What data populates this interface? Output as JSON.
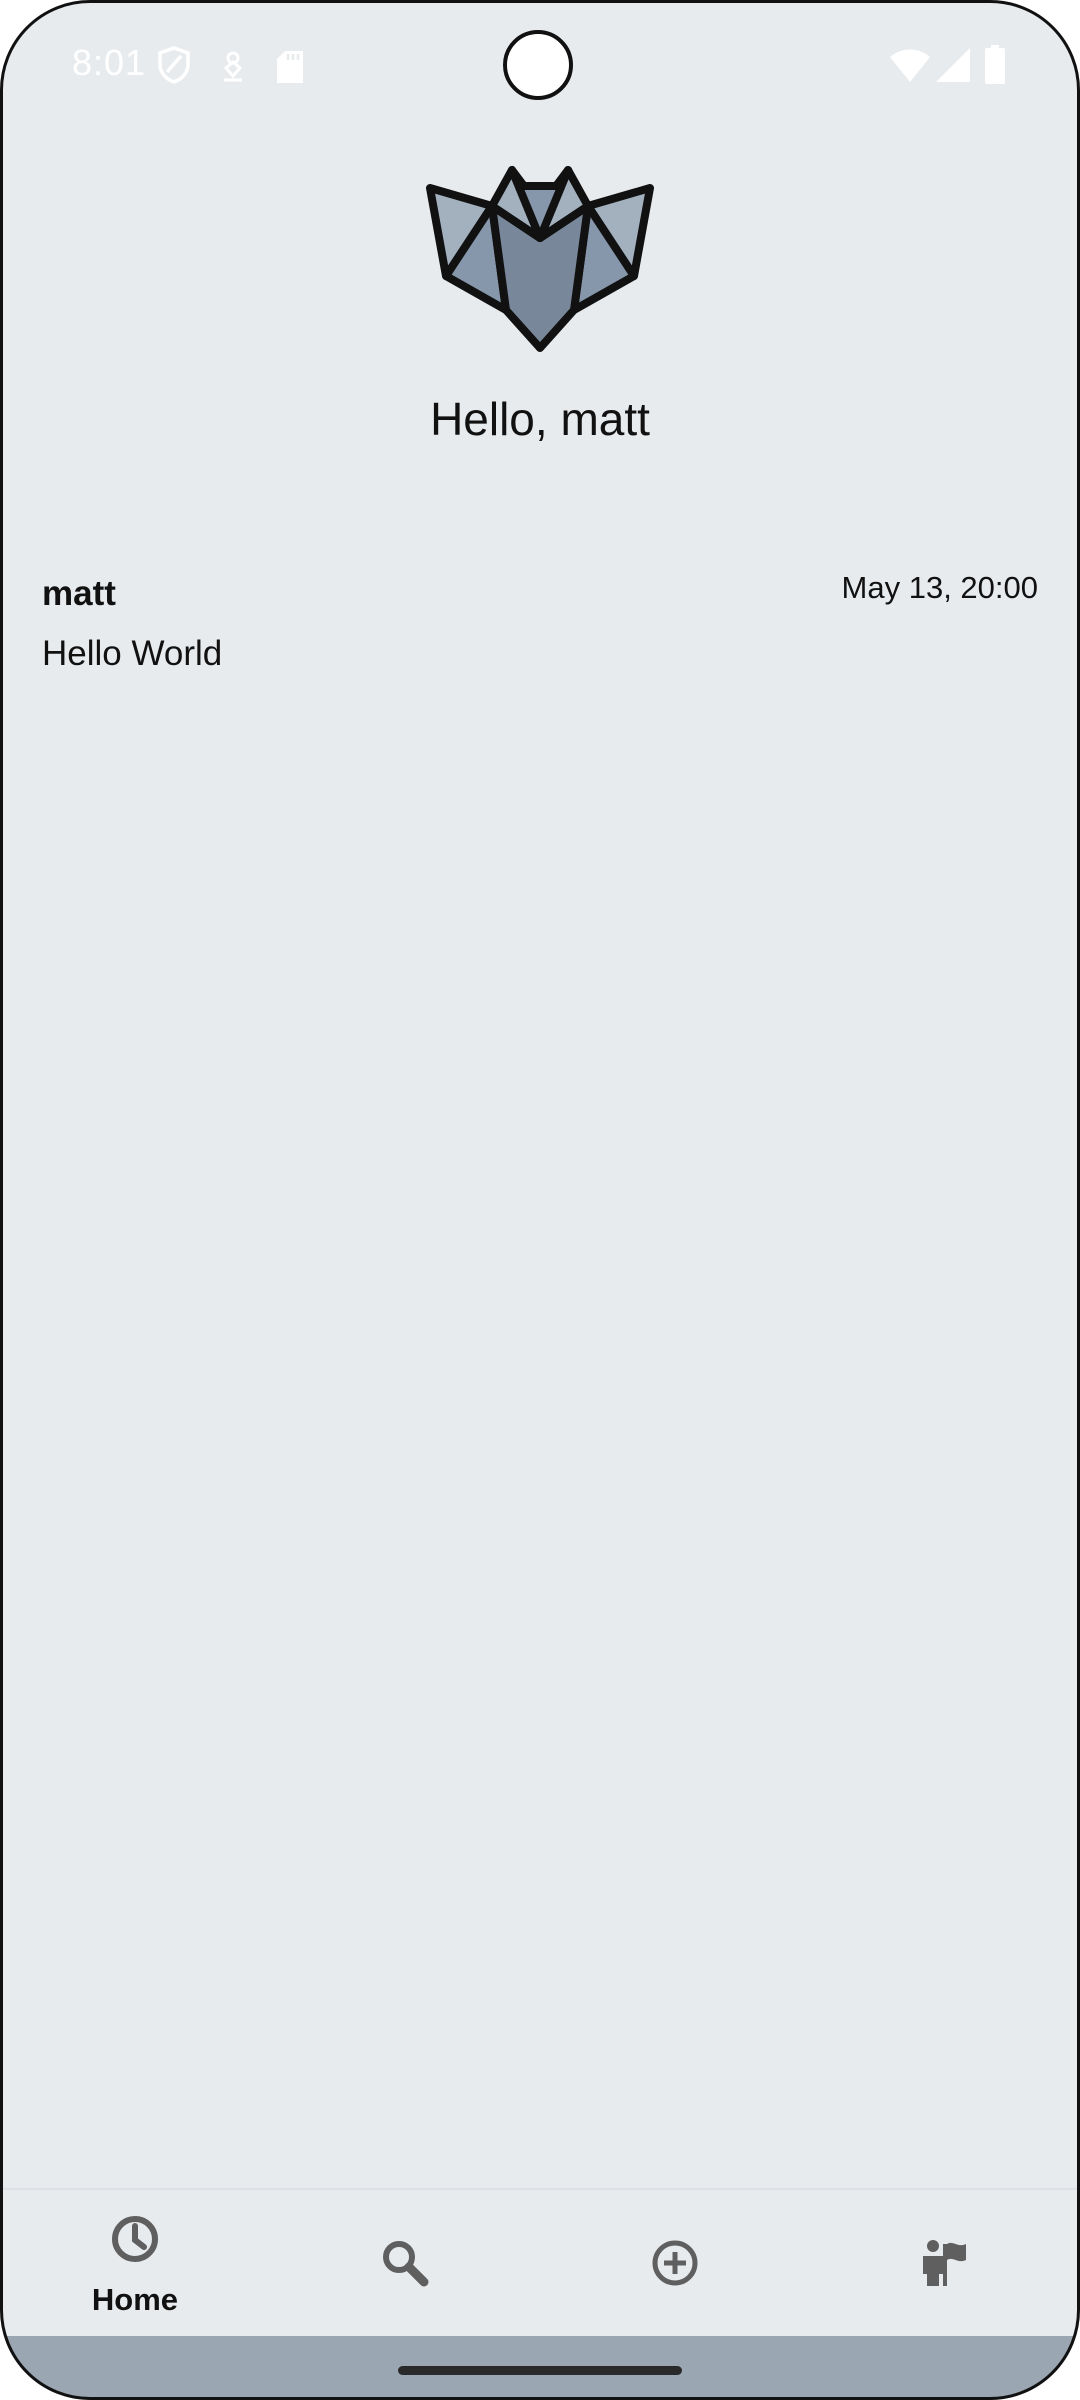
{
  "status_bar": {
    "time": "8:01",
    "icons": [
      "shield-icon",
      "location-icon",
      "sd-card-icon",
      "wifi-icon",
      "signal-icon",
      "battery-icon"
    ]
  },
  "header": {
    "logo": "bat-logo",
    "greeting": "Hello, matt"
  },
  "feed": {
    "posts": [
      {
        "author": "matt",
        "timestamp": "May 13, 20:00",
        "body": "Hello World"
      }
    ]
  },
  "bottom_nav": {
    "items": [
      {
        "icon": "clock-icon",
        "label": "Home",
        "active": true
      },
      {
        "icon": "search-icon",
        "label": ""
      },
      {
        "icon": "add-circle-icon",
        "label": ""
      },
      {
        "icon": "profile-flag-icon",
        "label": ""
      }
    ]
  },
  "colors": {
    "background": "#e8ebee",
    "logo_light": "#a3b1bf",
    "logo_mid": "#8797ab",
    "logo_dark": "#78889a",
    "nav_icon": "#5f5f5f",
    "gesture_area": "#9aa7b2"
  }
}
